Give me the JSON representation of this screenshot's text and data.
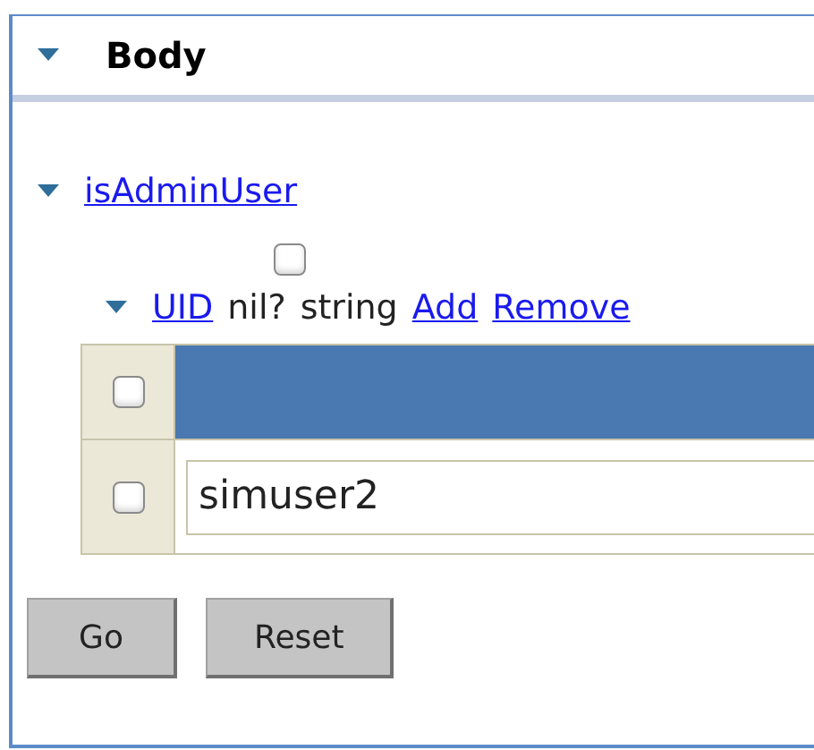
{
  "section": {
    "title": "Body",
    "expanded": true
  },
  "field": {
    "name": "isAdminUser",
    "expanded": true,
    "nil_checked": false
  },
  "array": {
    "name": "UID",
    "expanded": true,
    "nil_label": "nil?",
    "type": "string",
    "add": "Add",
    "remove": "Remove",
    "rows": [
      {
        "selected": true,
        "checked": false
      },
      {
        "selected": false,
        "checked": false,
        "value": "simuser2"
      }
    ]
  },
  "buttons": [
    "Go",
    "Reset"
  ]
}
